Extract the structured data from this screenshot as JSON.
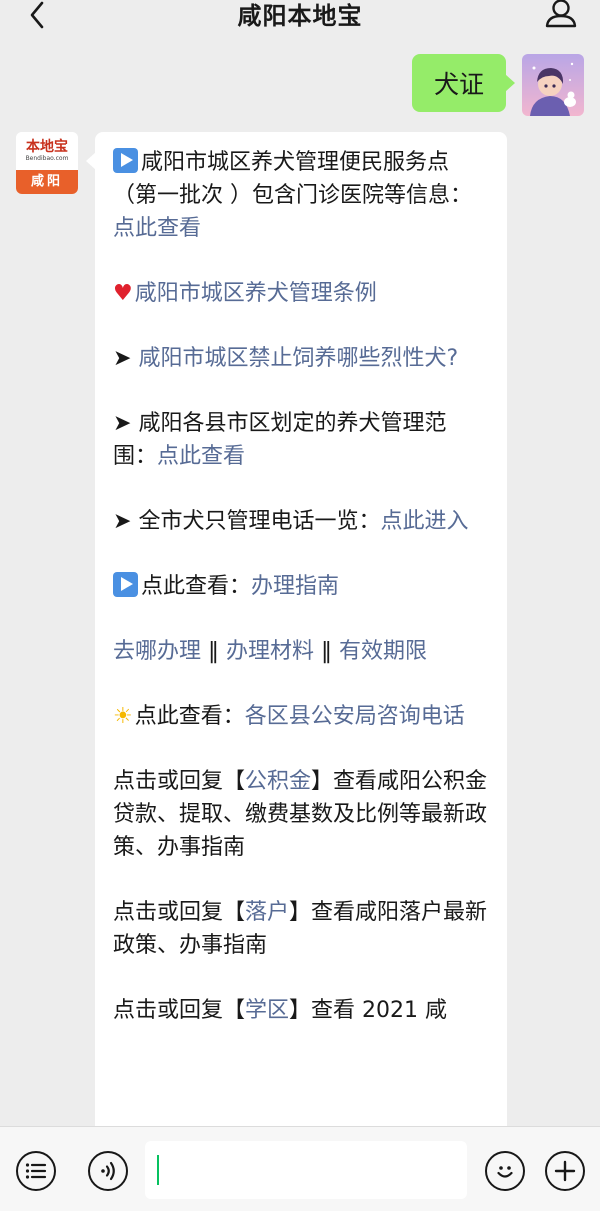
{
  "header": {
    "title": "咸阳本地宝"
  },
  "icons": {
    "back": "chevron-left-icon",
    "profile": "user-icon",
    "menu": "menu-list-icon",
    "voice": "voice-icon",
    "emoji": "smile-icon",
    "plus": "plus-icon"
  },
  "my_message": {
    "text": "犬证"
  },
  "bot_avatar": {
    "logo_name": "本地宝",
    "logo_sub": "Bendibao.com",
    "logo_city": "咸阳"
  },
  "bot_message": {
    "p1": {
      "text": "咸阳市城区养犬管理便民服务点（第一批次 ）包含门诊医院等信息：",
      "link": "点此查看"
    },
    "p2": {
      "link": "咸阳市城区养犬管理条例"
    },
    "p3": {
      "arrow": "➤ ",
      "link": "咸阳市城区禁止饲养哪些烈性犬?"
    },
    "p4": {
      "arrow": "➤ ",
      "text": "咸阳各县市区划定的养犬管理范围：",
      "link": "点此查看"
    },
    "p5": {
      "arrow": "➤ ",
      "text": "全市犬只管理电话一览：",
      "link": "点此进入"
    },
    "p6": {
      "text": "点此查看：",
      "link": "办理指南"
    },
    "p7": {
      "link1": "去哪办理",
      "sep1": " ‖ ",
      "link2": "办理材料",
      "sep2": " ‖ ",
      "link3": "有效期限"
    },
    "p8": {
      "text": "点此查看：",
      "link": "各区县公安局咨询电话"
    },
    "p9": {
      "pre": "点击或回复【",
      "link": "公积金",
      "post": "】查看咸阳公积金贷款、提取、缴费基数及比例等最新政策、办事指南"
    },
    "p10": {
      "pre": "点击或回复【",
      "link": "落户",
      "post": "】查看咸阳落户最新政策、办事指南"
    },
    "p11": {
      "pre": "点击或回复【",
      "link": "学区",
      "post": "】查看 2021 咸"
    }
  },
  "input": {
    "value": ""
  }
}
